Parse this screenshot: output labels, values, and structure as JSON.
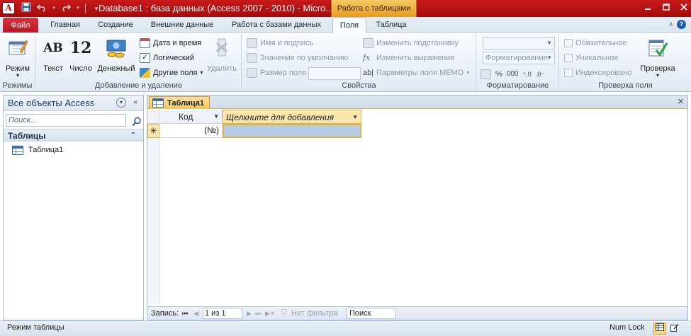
{
  "window": {
    "app_icon": "A",
    "title": "Database1 : база данных (Access 2007 - 2010)  -  Micro...",
    "context_tab": "Работа с таблицами",
    "controls": [
      "minimize-icon",
      "maximize-icon",
      "close-icon"
    ]
  },
  "quick_access": [
    "save-icon",
    "undo-icon",
    "redo-icon",
    "customize-icon"
  ],
  "ribbon_tabs": [
    {
      "label": "Файл"
    },
    {
      "label": "Главная"
    },
    {
      "label": "Создание"
    },
    {
      "label": "Внешние данные"
    },
    {
      "label": "Работа с базами данных"
    },
    {
      "label": "Поля",
      "active": true
    },
    {
      "label": "Таблица"
    }
  ],
  "ribbon": {
    "groups": {
      "modes": {
        "label": "Режимы",
        "mode_button": "Режим"
      },
      "add_delete": {
        "label": "Добавление и удаление",
        "text": "Текст",
        "number": "Число",
        "money": "Денежный",
        "datetime": "Дата и время",
        "logical": "Логический",
        "more_fields": "Другие поля",
        "delete": "Удалить"
      },
      "properties": {
        "label": "Свойства",
        "name_caption": "Имя и подпись",
        "default_value": "Значение по умолчанию",
        "field_size": "Размер поля",
        "change_lookup": "Изменить подстановку",
        "change_expression": "Изменить выражение",
        "memo_params": "Параметры поля MEMO"
      },
      "formatting": {
        "label": "Форматирование",
        "format_combo": "Форматирование",
        "percent": "%",
        "thousands": "000"
      },
      "validation": {
        "label": "Проверка поля",
        "required": "Обязательное",
        "unique": "Уникальное",
        "indexed": "Индексировано",
        "validate_button": "Проверка"
      }
    }
  },
  "nav_pane": {
    "title": "Все объекты Access",
    "search_placeholder": "Поиск...",
    "section": "Таблицы",
    "items": [
      {
        "label": "Таблица1"
      }
    ]
  },
  "document": {
    "tab_label": "Таблица1",
    "columns": [
      {
        "label": "Код"
      },
      {
        "label": "Щелкните для добавления"
      }
    ],
    "new_row": {
      "selector": "✳",
      "id_value": "(№)"
    }
  },
  "record_nav": {
    "label": "Запись:",
    "position": "1 из 1",
    "filter": "Нет фильтра",
    "search": "Поиск"
  },
  "status": {
    "left": "Режим таблицы",
    "right": "Num Lock"
  }
}
